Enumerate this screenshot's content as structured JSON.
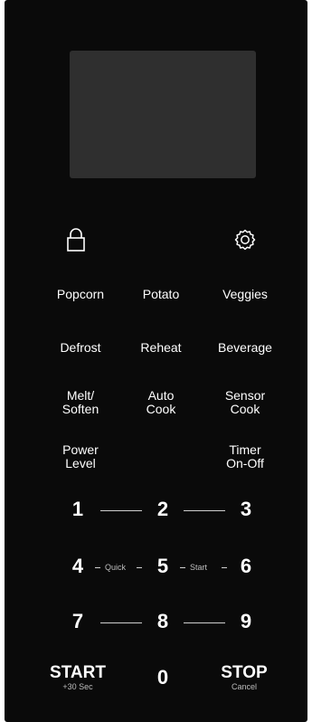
{
  "panel": {
    "icons": {
      "lock": "lock-icon",
      "settings": "gear-icon"
    },
    "buttons": {
      "popcorn": "Popcorn",
      "potato": "Potato",
      "veggies": "Veggies",
      "defrost": "Defrost",
      "reheat": "Reheat",
      "beverage": "Beverage",
      "melt_soften": "Melt/\nSoften",
      "auto_cook": "Auto\nCook",
      "sensor_cook": "Sensor\nCook",
      "power_level": "Power\nLevel",
      "timer_onoff": "Timer\nOn-Off"
    },
    "digits": [
      "1",
      "2",
      "3",
      "4",
      "5",
      "6",
      "7",
      "8",
      "9",
      "0"
    ],
    "quick_label": "Quick",
    "start_label": "Start",
    "start": {
      "label": "START",
      "sub": "+30 Sec"
    },
    "stop": {
      "label": "STOP",
      "sub": "Cancel"
    }
  }
}
